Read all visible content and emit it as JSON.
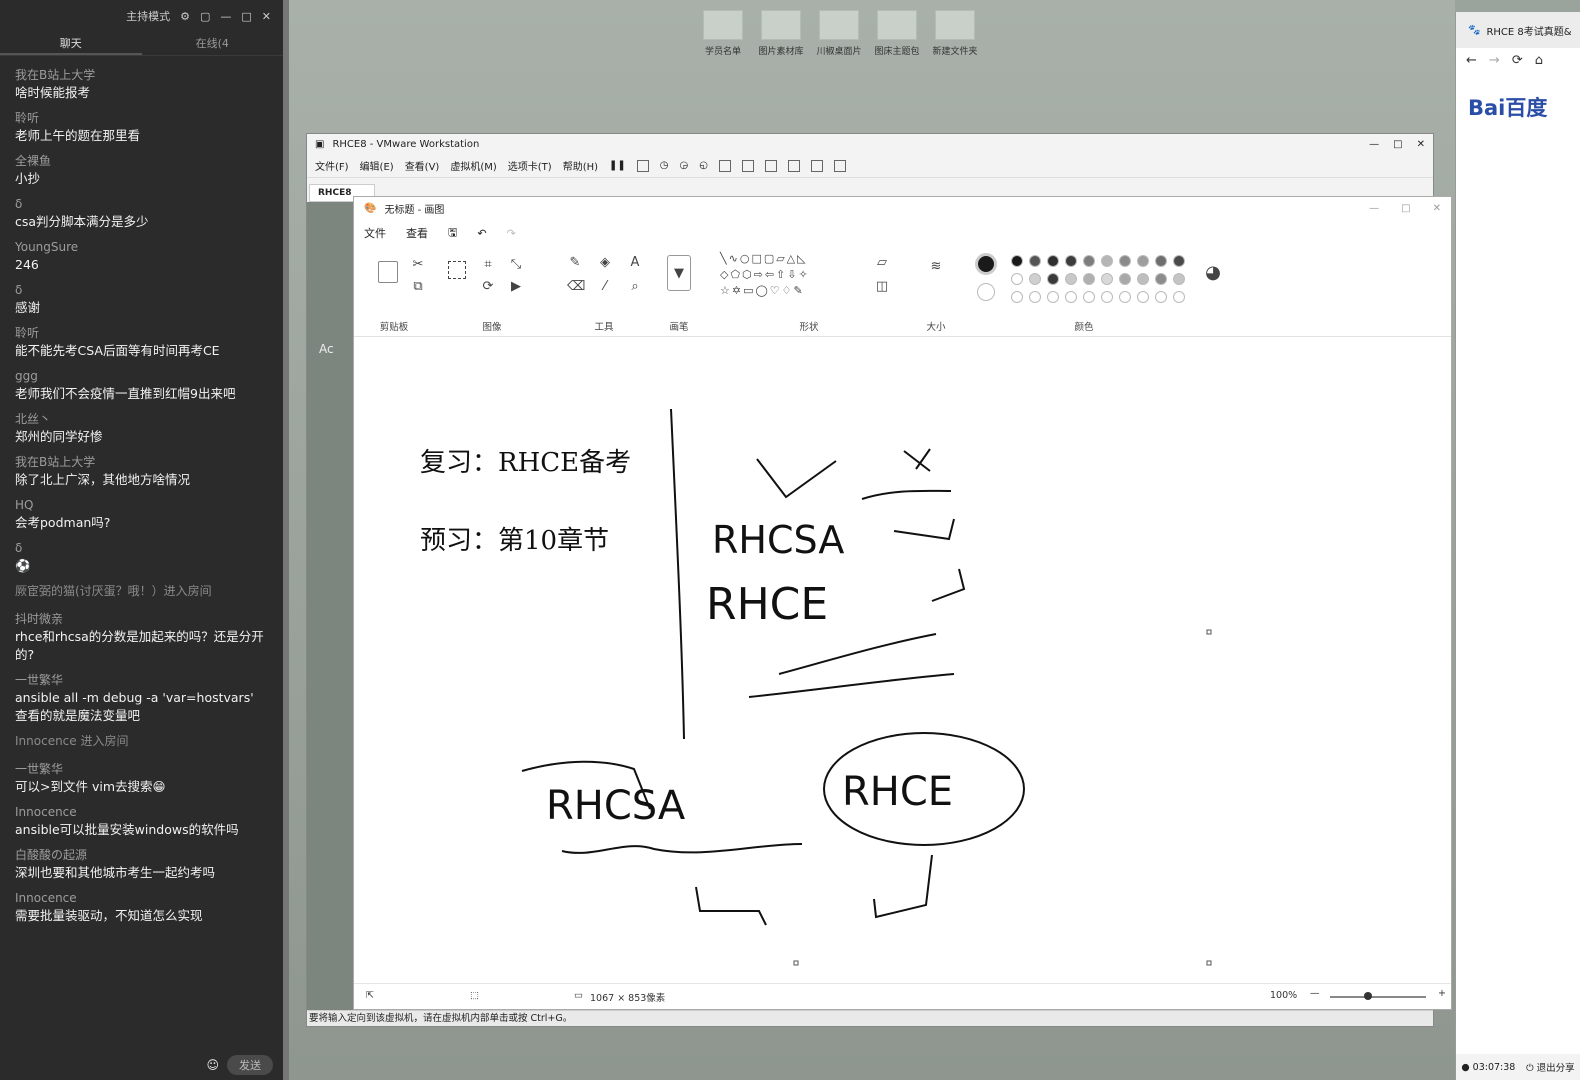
{
  "chat": {
    "header_label": "主持模式",
    "tabs": [
      "聊天",
      "在线(4"
    ],
    "messages": [
      {
        "nick": "我在B站上大学",
        "text": "啥时候能报考"
      },
      {
        "nick": "聆听",
        "text": "老师上午的题在那里看"
      },
      {
        "nick": "全裸鱼",
        "text": "小抄"
      },
      {
        "nick": "δ",
        "text": "csa判分脚本满分是多少"
      },
      {
        "nick": "YoungSure",
        "text": "246"
      },
      {
        "nick": "δ",
        "text": "感谢"
      },
      {
        "nick": "聆听",
        "text": "能不能先考CSA后面等有时间再考CE"
      },
      {
        "nick": "ggg",
        "text": "老师我们不会疫情一直推到红帽9出来吧"
      },
      {
        "nick": "北丝丶",
        "text": "郑州的同学好惨"
      },
      {
        "nick": "我在B站上大学",
        "text": "除了北上广深，其他地方啥情况"
      },
      {
        "nick": "HQ",
        "text": "会考podman吗?"
      },
      {
        "nick": "δ",
        "text": "⚽"
      }
    ],
    "system_1": "厥宦弼的猫(讨厌蛋？哦！）进入房间",
    "messages2": [
      {
        "nick": "抖时微亲",
        "text": "rhce和rhcsa的分数是加起来的吗？还是分开的?"
      },
      {
        "nick": "一世繁华",
        "text": "ansible all -m debug -a 'var=hostvars' 查看的就是魔法变量吧"
      }
    ],
    "system_2": "Innocence 进入房间",
    "messages3": [
      {
        "nick": "一世繁华",
        "text": "可以>到文件 vim去搜索😁"
      },
      {
        "nick": "Innocence",
        "text": "ansible可以批量安装windows的软件吗"
      },
      {
        "nick": "白酸酸の起源",
        "text": "深圳也要和其他城市考生一起约考吗"
      },
      {
        "nick": "Innocence",
        "text": "需要批量装驱动，不知道怎么实现"
      }
    ],
    "send_label": "发送"
  },
  "desktop_icons": [
    "学员名单",
    "图片素材库",
    "川椒桌面片",
    "图床主题包",
    "新建文件夹"
  ],
  "vmware": {
    "title": "RHCE8 - VMware Workstation",
    "menu": [
      "文件(F)",
      "编辑(E)",
      "查看(V)",
      "虚拟机(M)",
      "选项卡(T)",
      "帮助(H)"
    ],
    "tab_label": "RHCE8",
    "guest_text": "Ac",
    "status_text": "要将输入定向到该虚拟机，请在虚拟机内部单击或按 Ctrl+G。"
  },
  "paint": {
    "title": "无标题 - 画图",
    "menu": [
      "文件",
      "查看"
    ],
    "groups": [
      "剪贴板",
      "图像",
      "工具",
      "画笔",
      "形状",
      "大小",
      "颜色"
    ],
    "canvas_text": {
      "line1": "复习：RHCE备考",
      "line2": "预习：第10章节",
      "hw1": "RHCSA",
      "hw2": "RHCE",
      "hw3": "RHCSA",
      "hw4": "RHCE"
    },
    "status_size": "1067 × 853像素",
    "zoom": "100%"
  },
  "browser": {
    "tab_title": "RHCE 8考试真题&",
    "logo": "Bai百度",
    "time": "03:07:38",
    "exit_share": "退出分享"
  },
  "colors": {
    "chat_bg": "#2b2b2b",
    "palette_row1": [
      "#1a1a1a",
      "#555555",
      "#2f2f2f",
      "#3c3c3c",
      "#7d7d7d",
      "#b5b5b5",
      "#8a8a8a",
      "#9e9e9e",
      "#6e6e6e",
      "#4a4a4a"
    ],
    "palette_row2": [
      "#ffffff",
      "#cfcfcf",
      "#3a3a3a",
      "#c8c8c8",
      "#b0b0b0",
      "#d8d8d8",
      "#a8a8a8",
      "#bebebe",
      "#8c8c8c",
      "#c4c4c4"
    ]
  }
}
